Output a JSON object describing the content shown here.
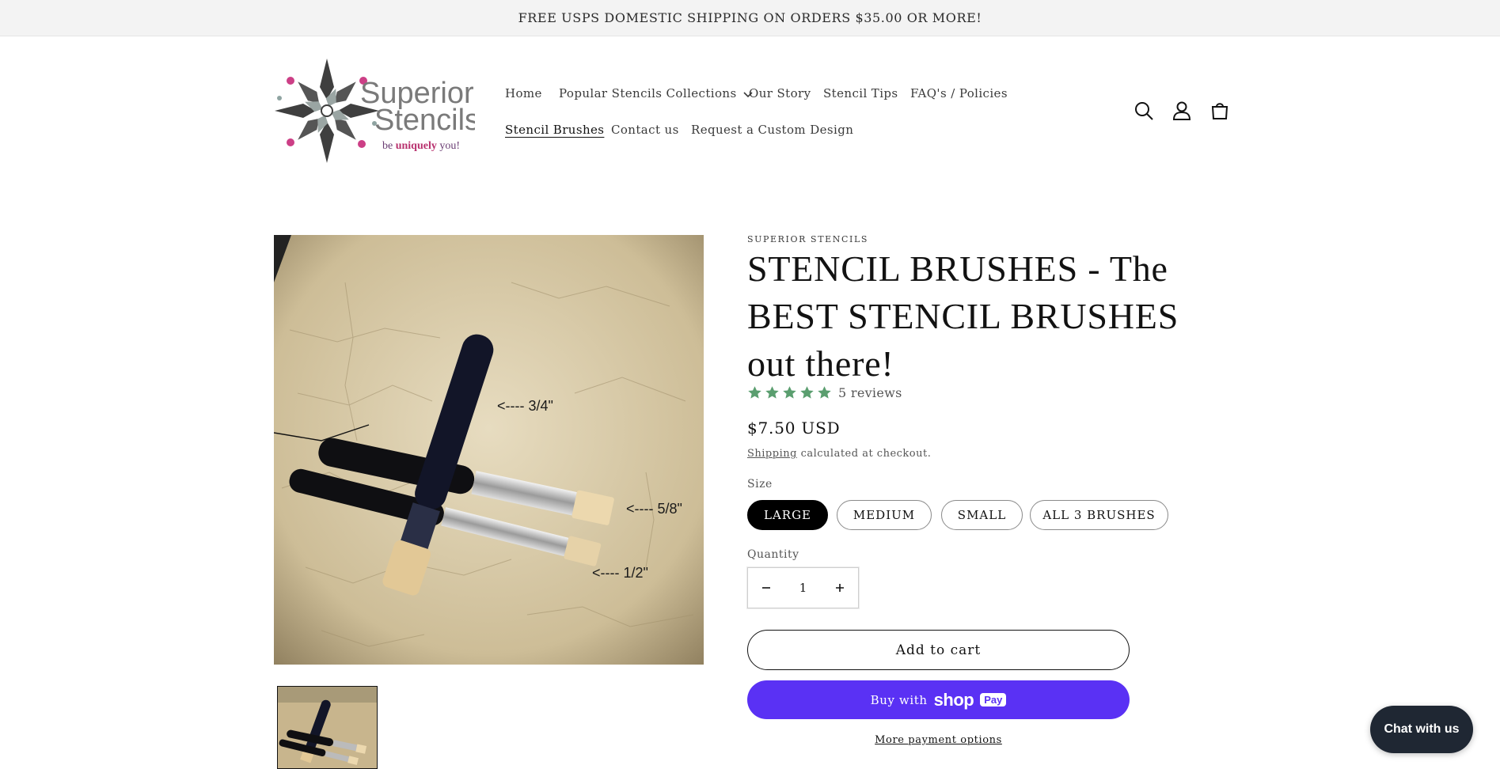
{
  "announcement": {
    "text": "FREE USPS DOMESTIC SHIPPING ON ORDERS $35.00 OR MORE!"
  },
  "logo": {
    "brand_line1": "Superior",
    "brand_line2": "Stencils",
    "tagline_prefix": "be ",
    "tagline_emphasis": "uniquely",
    "tagline_suffix": " you!"
  },
  "nav": {
    "items": [
      {
        "label": "Home"
      },
      {
        "label": "Popular Stencils Collections"
      },
      {
        "label": "Our Story"
      },
      {
        "label": "Stencil Tips"
      },
      {
        "label": "FAQ's / Policies"
      },
      {
        "label": "Stencil Brushes"
      },
      {
        "label": "Contact us"
      },
      {
        "label": "Request a Custom Design"
      }
    ],
    "active": "Stencil Brushes"
  },
  "header_icons": [
    "search-icon",
    "account-icon",
    "cart-icon"
  ],
  "product": {
    "vendor": "SUPERIOR STENCILS",
    "title": "STENCIL BRUSHES - The BEST STENCIL BRUSHES out there!",
    "rating": {
      "stars": 5,
      "reviews_text": "5 reviews",
      "star_color": "#5a9e6f"
    },
    "price": "$7.50 USD",
    "shipping_link": "Shipping",
    "shipping_suffix": " calculated at checkout.",
    "size_label": "Size",
    "sizes": [
      "LARGE",
      "MEDIUM",
      "SMALL",
      "ALL 3 BRUSHES"
    ],
    "selected_size": "LARGE",
    "quantity_label": "Quantity",
    "quantity": "1",
    "add_to_cart": "Add to cart",
    "buy_with": "Buy with",
    "shop_word": "shop",
    "pay_badge": "Pay",
    "more_payment": "More payment options",
    "image_labels": {
      "large": "<---- 3/4\"",
      "medium": "<---- 5/8\"",
      "small": "<---- 1/2\""
    }
  },
  "colors": {
    "shop_pay": "#5a31f4",
    "chat_bg": "#1f2733",
    "announcement_bg": "#f3f3f3"
  },
  "chat": {
    "label": "Chat with us"
  }
}
